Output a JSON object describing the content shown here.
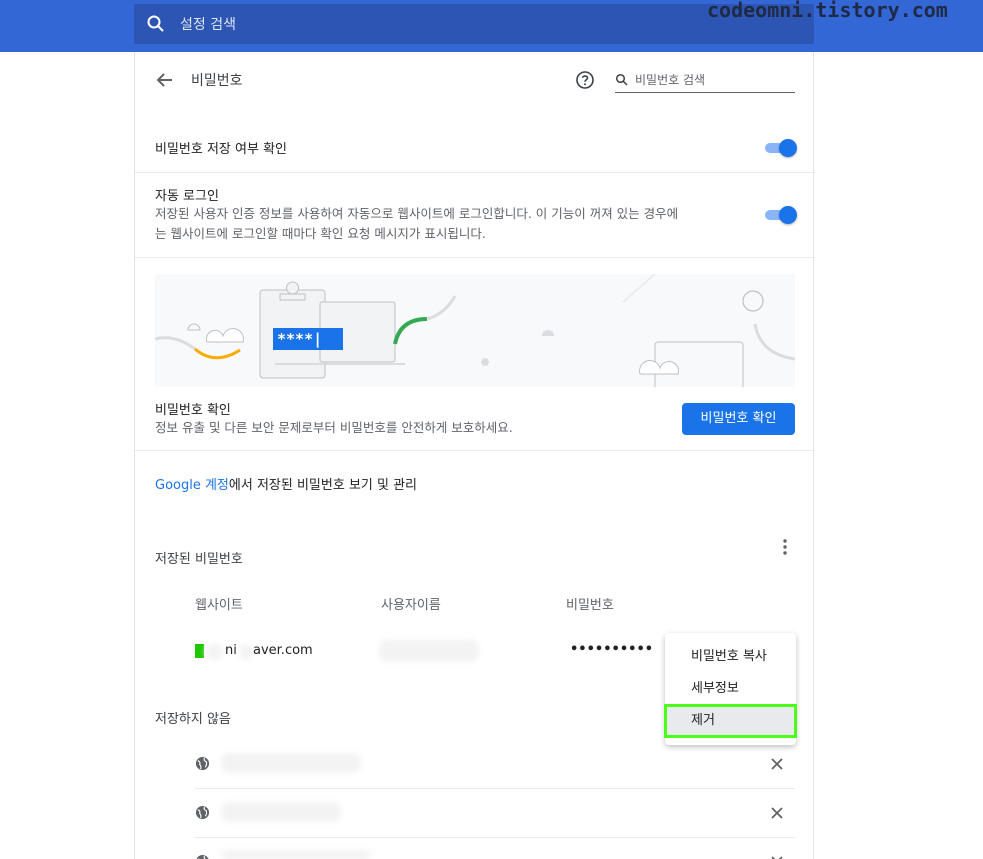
{
  "topbar": {
    "search_placeholder": "설정 검색",
    "watermark": "codeomni.tistory.com"
  },
  "header": {
    "title": "비밀번호",
    "search_placeholder": "비밀번호 검색"
  },
  "settings": {
    "offer_save": {
      "label": "비밀번호 저장 여부 확인",
      "enabled": true
    },
    "auto_signin": {
      "label": "자동 로그인",
      "desc_line1": "저장된 사용자 인증 정보를 사용하여 자동으로 웹사이트에 로그인합니다. 이 기능이 꺼져 있는 경우에",
      "desc_line2": "는 웹사이트에 로그인할 때마다 확인 요청 메시지가 표시됩니다.",
      "enabled": true
    }
  },
  "banner": {
    "masked_text": "****|"
  },
  "checkup": {
    "title": "비밀번호 확인",
    "desc": "정보 유출 및 다른 보안 문제로부터 비밀번호를 안전하게 보호하세요.",
    "button_label": "비밀번호 확인"
  },
  "google_account": {
    "link_text": "Google 계정",
    "rest_text": "에서 저장된 비밀번호 보기 및 관리"
  },
  "saved": {
    "heading": "저장된 비밀번호",
    "columns": [
      "웹사이트",
      "사용자이름",
      "비밀번호"
    ],
    "rows": [
      {
        "site_prefix": "ni",
        "site_suffix": "aver.com",
        "password_mask": "••••••••••"
      }
    ]
  },
  "menu": {
    "items": [
      "비밀번호 복사",
      "세부정보",
      "제거"
    ],
    "highlighted_index": 2
  },
  "never_saved": {
    "heading": "저장하지 않음",
    "row_count": 3
  },
  "colors": {
    "accent": "#1a73e8",
    "topbar": "#3367d6",
    "highlight_outline": "#4cff1a",
    "green_site": "#1ec800"
  }
}
